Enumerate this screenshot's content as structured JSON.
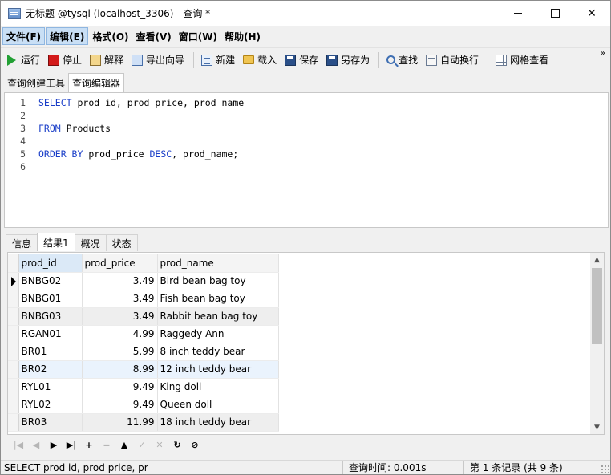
{
  "window": {
    "title": "无标题 @tysql (localhost_3306) - 查询 *"
  },
  "menu": [
    "文件(F)",
    "编辑(E)",
    "格式(O)",
    "查看(V)",
    "窗口(W)",
    "帮助(H)"
  ],
  "toolbar": {
    "run": "运行",
    "stop": "停止",
    "explain": "解释",
    "export_wizard": "导出向导",
    "new": "新建",
    "load": "载入",
    "save": "保存",
    "save_as": "另存为",
    "find": "查找",
    "word_wrap": "自动换行",
    "grid_view": "网格查看",
    "overflow": "»"
  },
  "editor_tabs": [
    "查询创建工具",
    "查询编辑器"
  ],
  "editor": {
    "lines": [
      {
        "n": "1",
        "parts": [
          [
            "kw",
            "SELECT"
          ],
          [
            "",
            " prod_id, prod_price, prod_name"
          ]
        ]
      },
      {
        "n": "2",
        "parts": []
      },
      {
        "n": "3",
        "parts": [
          [
            "kw",
            "FROM"
          ],
          [
            "",
            " Products"
          ]
        ]
      },
      {
        "n": "4",
        "parts": []
      },
      {
        "n": "5",
        "parts": [
          [
            "kw",
            "ORDER BY"
          ],
          [
            "",
            " prod_price "
          ],
          [
            "kw",
            "DESC"
          ],
          [
            "",
            ", prod_name;"
          ]
        ]
      },
      {
        "n": "6",
        "parts": []
      }
    ]
  },
  "result_tabs": [
    "信息",
    "结果1",
    "概况",
    "状态"
  ],
  "grid": {
    "columns": [
      "prod_id",
      "prod_price",
      "prod_name"
    ],
    "rows": [
      [
        "BNBG02",
        "3.49",
        "Bird bean bag toy"
      ],
      [
        "BNBG01",
        "3.49",
        "Fish bean bag toy"
      ],
      [
        "BNBG03",
        "3.49",
        "Rabbit bean bag toy"
      ],
      [
        "RGAN01",
        "4.99",
        "Raggedy Ann"
      ],
      [
        "BR01",
        "5.99",
        "8 inch teddy bear"
      ],
      [
        "BR02",
        "8.99",
        "12 inch teddy bear"
      ],
      [
        "RYL01",
        "9.49",
        "King doll"
      ],
      [
        "RYL02",
        "9.49",
        "Queen doll"
      ],
      [
        "BR03",
        "11.99",
        "18 inch teddy bear"
      ]
    ]
  },
  "nav": [
    "|◀",
    "◀",
    "▶",
    "▶|",
    "+",
    "−",
    "▲",
    "✓",
    "✕",
    "↻",
    "⊘"
  ],
  "status": {
    "sql": "SELECT prod id, prod price, pr",
    "query_time": "查询时间: 0.001s",
    "records": "第 1 条记录 (共 9 条)"
  }
}
